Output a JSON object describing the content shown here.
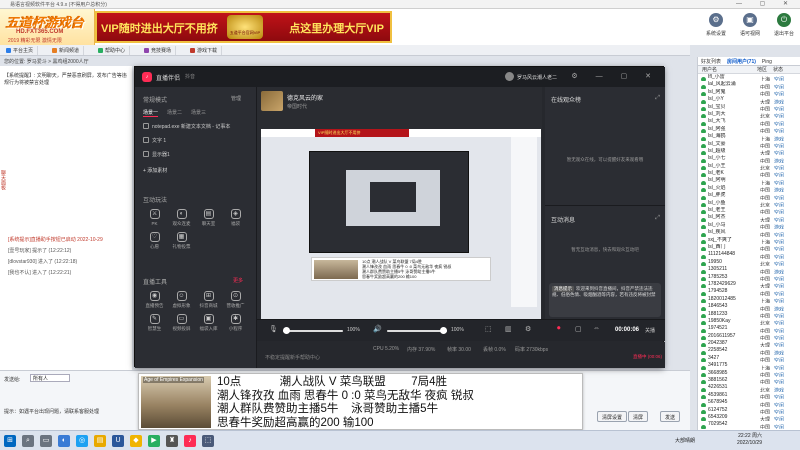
{
  "titlebar": {
    "title": "易语言视频软件平台 4.9.x (不得用户总积分)"
  },
  "banner": {
    "logo_main": "五道杯游戏台",
    "logo_url": "HD.FXT365.COM",
    "logo_sub": "2019 精彩无限 激情无限",
    "ad_left": "VIP随时进出大厅不用挤",
    "ad_right": "点这里办理大厅VIP",
    "ad_emblem": "五道平台官网VIP",
    "buttons": [
      {
        "label": "系统设置",
        "icon": "gear-icon"
      },
      {
        "label": "语可视网",
        "icon": "monitor-icon"
      },
      {
        "label": "退出平台",
        "icon": "exit-icon"
      }
    ]
  },
  "tabs": [
    "平台主页",
    "新闻频道",
    "帮助中心",
    "竞技赛场",
    "游戏下载"
  ],
  "crumb": "您的位置: 罗马爱斗 > 黑鸡组2000人厅",
  "announcement": "【系统提醒】: 文明聊天，严禁恶意刷屏，发布广告等违规行为将被禁言处理",
  "sidehint": "聊天面板",
  "chatlog": [
    {
      "text": "[系统提示]直播助手按钮已启动 2022-10-29",
      "red": true
    },
    {
      "text": "[壹号玩家] 提示了 (12:22:12)",
      "red": false
    },
    {
      "text": "[dlovstar930] 进入了 (12:22:18)",
      "red": false
    },
    {
      "text": "[我也不认] 进入了 (12:22:21)",
      "red": false
    }
  ],
  "bottombar": {
    "send_label": "发送给:",
    "send_to": "所有人",
    "tip": "提示：如遇平台出现问题，请联系客服处理",
    "buttons": [
      "发送",
      "清屏设置",
      "清屏"
    ]
  },
  "userpanel": {
    "tabs": [
      "好友列表",
      "房间用户(71)",
      "Ping"
    ],
    "columns": [
      "用户名",
      "地区",
      "状态"
    ],
    "users": [
      [
        "Ifl_小雷",
        "上海",
        "空闲"
      ],
      [
        "lal_风起云涌",
        "中国",
        "空闲"
      ],
      [
        "lsl_阿鬼",
        "中国",
        "空闲"
      ],
      [
        "lsl_小Y",
        "大理",
        "游戏"
      ],
      [
        "lsl_宝贝",
        "中国",
        "空闲"
      ],
      [
        "lsl_刘大",
        "北京",
        "空闲"
      ],
      [
        "lsl_大飞",
        "中国",
        "空闲"
      ],
      [
        "lsl_阿强",
        "中国",
        "空闲"
      ],
      [
        "lsl_海鸥",
        "上海",
        "游戏"
      ],
      [
        "lsl_文豪",
        "中国",
        "空闲"
      ],
      [
        "lsl_超级",
        "大理",
        "空闲"
      ],
      [
        "lsl_小七",
        "中国",
        "游戏"
      ],
      [
        "lsl_小王",
        "北京",
        "空闲"
      ],
      [
        "lsl_老K",
        "中国",
        "空闲"
      ],
      [
        "lsl_阿明",
        "上海",
        "空闲"
      ],
      [
        "lsl_火焰",
        "中国",
        "游戏"
      ],
      [
        "lsl_胖虎",
        "中国",
        "空闲"
      ],
      [
        "lsl_小鱼",
        "北京",
        "空闲"
      ],
      [
        "lsl_老王",
        "中国",
        "空闲"
      ],
      [
        "lsl_阿杰",
        "大理",
        "空闲"
      ],
      [
        "lsl_小马",
        "中国",
        "游戏"
      ],
      [
        "lsl_疾风",
        "中国",
        "空闲"
      ],
      [
        "sxj_不爽了",
        "上海",
        "空闲"
      ],
      [
        "lsl_西门",
        "中国",
        "空闲"
      ],
      [
        "1112144848",
        "中国",
        "空闲"
      ],
      [
        "19950",
        "北京",
        "空闲"
      ],
      [
        "1305211",
        "中国",
        "游戏"
      ],
      [
        "1785253",
        "中国",
        "空闲"
      ],
      [
        "1782429629",
        "大理",
        "空闲"
      ],
      [
        "1794528",
        "中国",
        "空闲"
      ],
      [
        "1820012485",
        "上海",
        "空闲"
      ],
      [
        "1846543",
        "中国",
        "游戏"
      ],
      [
        "1881233",
        "中国",
        "空闲"
      ],
      [
        "19850Kay",
        "北京",
        "空闲"
      ],
      [
        "1974521",
        "中国",
        "空闲"
      ],
      [
        "2016611957",
        "中国",
        "空闲"
      ],
      [
        "2042387",
        "大理",
        "空闲"
      ],
      [
        "2258542",
        "中国",
        "游戏"
      ],
      [
        "3427",
        "中国",
        "空闲"
      ],
      [
        "3491775",
        "上海",
        "空闲"
      ],
      [
        "3668985",
        "中国",
        "空闲"
      ],
      [
        "3881562",
        "中国",
        "空闲"
      ],
      [
        "4226531",
        "北京",
        "游戏"
      ],
      [
        "4539861",
        "中国",
        "空闲"
      ],
      [
        "5678945",
        "中国",
        "空闲"
      ],
      [
        "6124752",
        "中国",
        "空闲"
      ],
      [
        "6543209",
        "大理",
        "空闲"
      ],
      [
        "7029542",
        "中国",
        "空闲"
      ]
    ]
  },
  "studio": {
    "app_name": "直播伴侣",
    "app_ver": "抖音",
    "account": "罗马风云潮人老二",
    "room_title": "德克风云的家",
    "room_sub": "帝国时代",
    "scenes_header": "常规模式",
    "scenes_manage": "管理",
    "modes": [
      "场景一",
      "场景二",
      "场景三"
    ],
    "sources": [
      "notepad.exe 新建文本文档 - 记事本",
      "文字 1",
      "显示器1"
    ],
    "add_source": "+ 添加素材",
    "interact_header": "互动玩法",
    "interact": [
      "PK",
      "观众连麦",
      "聊天室",
      "福袋",
      "心愿",
      "礼物投票"
    ],
    "tools_header": "直播工具",
    "tools_more": "更多",
    "tools": [
      "直播预告",
      "虚拟形象",
      "抖音商城",
      "营收推广",
      "智慧生",
      "视频投屏",
      "福袋入库",
      "小程序"
    ],
    "right_hd1": "在线观众榜",
    "right_empty1": "暂无观众在线，可以提醒好友来观看哦",
    "right_hd2": "互动消息",
    "right_empty2": "暂无互动消息，快去和观众互动吧",
    "bubble_tag": "消息提示",
    "bubble_text": "欢迎来到抖音直播间，抖音严禁违法违规、低俗色情、吸烟酗酒等内容，若有违反将被封禁",
    "ctrl": {
      "mic_pct": "100%",
      "spk_pct": "100%",
      "timer": "00:00:06",
      "live_btn": "关播"
    },
    "stats": [
      "CPU 5.20%",
      "内存 37.90%",
      "帧率 30.00",
      "丢帧 0.0%",
      "码率 2730kbps"
    ],
    "tip": "不稳定提醒新手帮助中心",
    "warn": "直播中 (00:06)"
  },
  "overlay": {
    "thumb_caption": "Age of Empires Expansion",
    "lines": [
      "10点            潮人战队 V 菜鸟联盟        7局4胜",
      "潮人锋孜孜 血雨 思春牛 0 :0 菜鸟无敌华 夜疯 锐叔",
      "潮人群队费赞助主播5牛    泳哥赞助主播5牛",
      "思春牛奖励超高赢的200 输100"
    ]
  },
  "taskbar": {
    "tray": "大部晴朗",
    "time": "22:22 周六",
    "date": "2022/10/29"
  }
}
